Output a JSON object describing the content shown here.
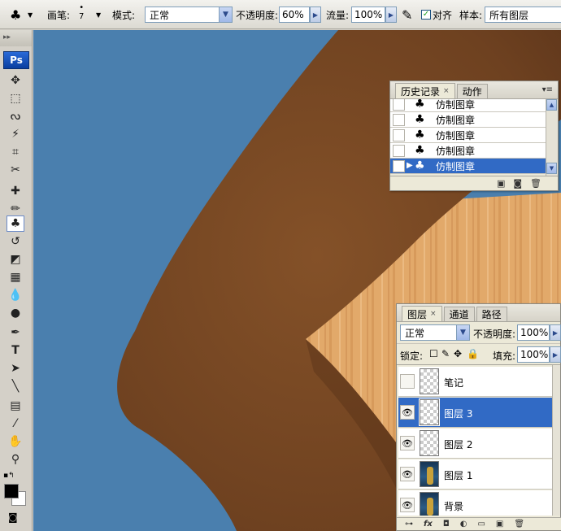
{
  "options_bar": {
    "tool_icon": "clone-stamp-icon",
    "brush_label": "画笔:",
    "brush_size": "7",
    "mode_label": "模式:",
    "mode_value": "正常",
    "opacity_label": "不透明度:",
    "opacity_value": "60%",
    "flow_label": "流量:",
    "flow_value": "100%",
    "aligned_label": "对齐",
    "aligned_checked": true,
    "sample_label": "样本:",
    "sample_value": "所有图层"
  },
  "toolbox": {
    "logo": "Ps",
    "tools": [
      "move-icon",
      "marquee-icon",
      "lasso-icon",
      "magic-wand-icon",
      "crop-icon",
      "slice-icon",
      "healing-brush-icon",
      "brush-icon",
      "clone-stamp-icon",
      "history-brush-icon",
      "eraser-icon",
      "gradient-icon",
      "blur-icon",
      "dodge-icon",
      "pen-icon",
      "type-icon",
      "path-select-icon",
      "line-icon",
      "notes-icon",
      "eyedropper-icon",
      "hand-icon",
      "zoom-icon"
    ],
    "active_tool": "clone-stamp-icon"
  },
  "history_panel": {
    "tabs": [
      "历史记录",
      "动作"
    ],
    "active_tab": "历史记录",
    "items": [
      "仿制图章",
      "仿制图章",
      "仿制图章",
      "仿制图章",
      "仿制图章"
    ],
    "selected_index": 4
  },
  "layers_panel": {
    "tabs": [
      "图层",
      "通道",
      "路径"
    ],
    "active_tab": "图层",
    "blend_mode": "正常",
    "opacity_label": "不透明度:",
    "opacity_value": "100%",
    "lock_label": "锁定:",
    "fill_label": "填充:",
    "fill_value": "100%",
    "layers": [
      {
        "name": "笔记",
        "visible": false,
        "thumb": "transparent"
      },
      {
        "name": "图层 3",
        "visible": true,
        "thumb": "transparent",
        "selected": true
      },
      {
        "name": "图层 2",
        "visible": true,
        "thumb": "transparent"
      },
      {
        "name": "图层 1",
        "visible": true,
        "thumb": "photo"
      },
      {
        "name": "背景",
        "visible": true,
        "thumb": "photo"
      }
    ]
  },
  "colors": {
    "canvas_bg": "#4a7fae",
    "skin": "#7a4a22",
    "wood": "#e0a868",
    "selection": "#316ac5"
  }
}
